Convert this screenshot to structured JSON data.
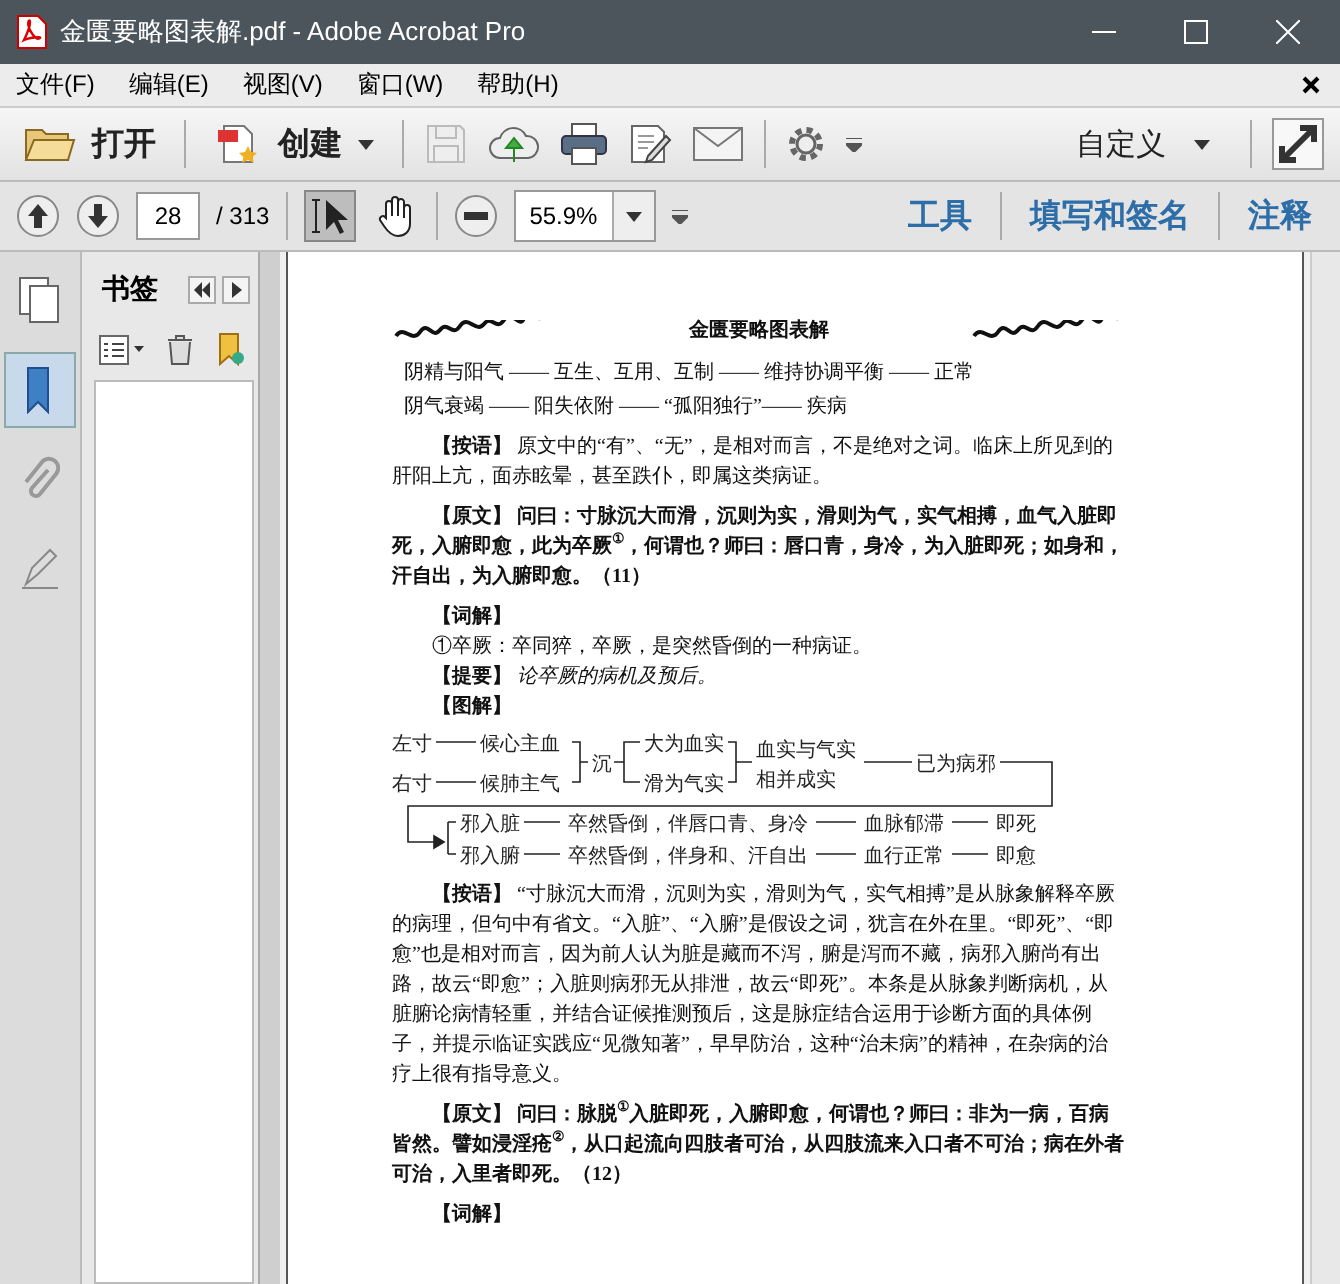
{
  "window": {
    "title": "金匮要略图表解.pdf - Adobe Acrobat Pro"
  },
  "menu": [
    "文件(F)",
    "编辑(E)",
    "视图(V)",
    "窗口(W)",
    "帮助(H)"
  ],
  "toolbar": {
    "open": "打开",
    "create": "创建",
    "customize": "自定义"
  },
  "nav": {
    "page": "28",
    "total": "/ 313",
    "zoom": "55.9%",
    "tools": [
      {
        "kind": "select",
        "selected": true
      },
      {
        "kind": "hand",
        "selected": false
      }
    ],
    "panes": [
      "工具",
      "填写和签名",
      "注释"
    ]
  },
  "sidebar": {
    "tabs": [
      {
        "kind": "pages",
        "selected": false
      },
      {
        "kind": "bookmarks",
        "selected": true
      },
      {
        "kind": "attachments",
        "selected": false
      },
      {
        "kind": "signatures",
        "selected": false
      }
    ],
    "panel_title": "书签"
  },
  "document": {
    "running_head": "金匮要略图表解",
    "blocks": [
      {
        "kind": "flow",
        "text": "阴精与阳气 —— 互生、互用、互制 —— 维持协调平衡 —— 正常"
      },
      {
        "kind": "flow",
        "text": "阴气衰竭 —— 阳失依附 —— “孤阳独行”—— 疾病"
      },
      {
        "kind": "para",
        "text": "**【按语】** 原文中的“有”、“无”，是相对而言，不是绝对之词。临床上所见到的肝阳上亢，面赤眩晕，甚至跌仆，即属这类病证。"
      },
      {
        "kind": "original",
        "text": "【原文】 问曰：寸脉沉大而滑，沉则为实，滑则为气，实气相搏，血气入脏即死，入腑即愈，此为卒厥$^{①}$，何谓也？师曰：唇口青，身冷，为入脏即死；如身和，汗自出，为入腑即愈。（11）"
      },
      {
        "kind": "line",
        "text": "**【词解】**"
      },
      {
        "kind": "line",
        "text": "①卒厥：卒同猝，卒厥，是突然昏倒的一种病证。"
      },
      {
        "kind": "line",
        "text": "**【提要】** *论卒厥的病机及预后。*"
      },
      {
        "kind": "line",
        "text": "**【图解】**"
      },
      {
        "kind": "diagram",
        "nodes": [
          "左寸",
          "候心主血",
          "右寸",
          "候肺主气",
          "沉",
          "大为血实",
          "滑为气实",
          "血实与气实",
          "相并成实",
          "已为病邪",
          "邪入脏",
          "卒然昏倒，伴唇口青、身冷",
          "血脉郁滞",
          "即死",
          "邪入腑",
          "卒然昏倒，伴身和、汗自出",
          "血行正常",
          "即愈"
        ]
      },
      {
        "kind": "para",
        "text": "**【按语】** “寸脉沉大而滑，沉则为实，滑则为气，实气相搏”是从脉象解释卒厥的病理，但句中有省文。“入脏”、“入腑”是假设之词，犹言在外在里。“即死”、“即愈”也是相对而言，因为前人认为脏是藏而不泻，腑是泻而不藏，病邪入腑尚有出路，故云“即愈”；入脏则病邪无从排泄，故云“即死”。本条是从脉象判断病机，从脏腑论病情轻重，并结合证候推测预后，这是脉症结合运用于诊断方面的具体例子，并提示临证实践应“见微知著”，早早防治，这种“治未病”的精神，在杂病的治疗上很有指导意义。"
      },
      {
        "kind": "original",
        "text": "【原文】 问曰：脉脱$^{①}$入脏即死，入腑即愈，何谓也？师曰：非为一病，百病皆然。譬如浸淫疮$^{②}$，从口起流向四肢者可治，从四肢流来入口者不可治；病在外者可治，入里者即死。（12）"
      },
      {
        "kind": "line",
        "text": "**【词解】**"
      }
    ]
  }
}
